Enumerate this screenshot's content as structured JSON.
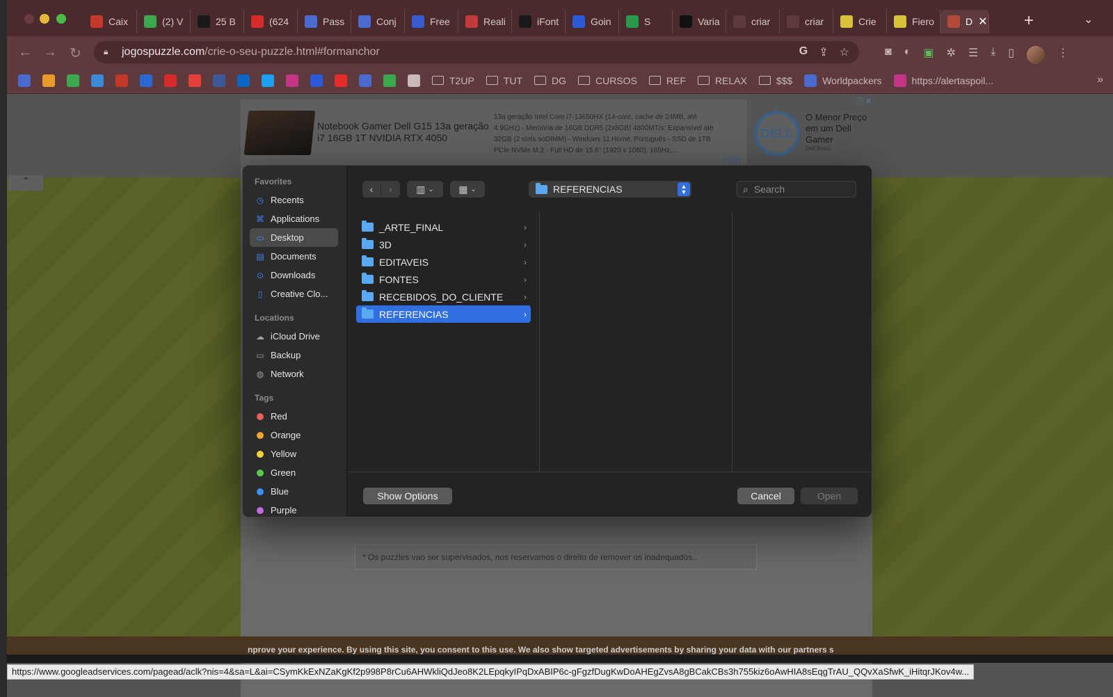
{
  "browser": {
    "tabs": [
      {
        "title": "Caix",
        "icon": "gmail-icon",
        "color": "#c5392b"
      },
      {
        "title": "(2) V",
        "icon": "whatsapp-icon",
        "color": "#3aa94d"
      },
      {
        "title": "25 B",
        "icon": "s-logo-icon",
        "color": "#1a1a1a"
      },
      {
        "title": "(624",
        "icon": "pinterest-icon",
        "color": "#d62b2b"
      },
      {
        "title": "Pass",
        "icon": "forms-icon",
        "color": "#4a6ad0"
      },
      {
        "title": "Conj",
        "icon": "forms-icon",
        "color": "#4a6ad0"
      },
      {
        "title": "Free",
        "icon": "freepik-icon",
        "color": "#3a5ad0"
      },
      {
        "title": "Reali",
        "icon": "realidade-icon",
        "color": "#c23a3a"
      },
      {
        "title": "iFont",
        "icon": "ifont-icon",
        "color": "#1a1a1a"
      },
      {
        "title": "Goin",
        "icon": "behance-icon",
        "color": "#2a5ad8"
      },
      {
        "title": "S",
        "icon": "spotify-icon",
        "color": "#2a9a4a"
      },
      {
        "title": "Varia",
        "icon": "video-icon",
        "color": "#111111"
      },
      {
        "title": "criar",
        "icon": "google-icon",
        "color": "#5f3a3d"
      },
      {
        "title": "criar",
        "icon": "google-icon",
        "color": "#5f3a3d"
      },
      {
        "title": "Crie",
        "icon": "smiley-icon",
        "color": "#d8c23a"
      },
      {
        "title": "Fiero",
        "icon": "smiley-icon",
        "color": "#d8c23a"
      },
      {
        "title": "D",
        "icon": "puzzle-icon",
        "color": "#b24a3a",
        "active": true
      }
    ],
    "url_domain": "jogospuzzle.com",
    "url_path": "/crie-o-seu-puzzle.html#formanchor",
    "bookmarks_folders": [
      "T2UP",
      "TUT",
      "DG",
      "CURSOS",
      "REF",
      "RELAX",
      "$$$"
    ],
    "bookmark_worldpackers": "Worldpackers",
    "bookmark_alerta": "https://alertaspoil...",
    "bookmark_icon_colors": [
      "#4a6ad0",
      "#e89a2a",
      "#3aa94d",
      "#3a8ad8",
      "#c5392b",
      "#2a6ad0",
      "#d62b2b",
      "#e6403a",
      "#3b5998",
      "#0a66c2",
      "#1da1f2",
      "#c13584",
      "#2a5ad8",
      "#e62b2b",
      "#4a6ad0",
      "#3aa94d",
      "#c8b8b8"
    ]
  },
  "ad": {
    "title": "Notebook Gamer Dell G15 13a geração i7 16GB 1T NVIDIA RTX 4050",
    "description": "13a geração Intel Core i7-13650HX (14-core, cache de 24MB, até 4.9GHz) - Memória de 16GB DDR5 (2x8GB) 4800MT/s: Expansível até 32GB (2 slots soDIMM) - Windows 11 Home, Português - SSD de 1TB PCIe NVMe M.2 - Full HD de 15.6\" (1920 x 1080), 165Hz,...",
    "badge": "-9%",
    "brand_logo": "DELL",
    "brand_tagline": "O Menor Preço em um Dell Gamer",
    "brand_sub": "Dell Brasil"
  },
  "page": {
    "notice": "* Os puzzles vao ser supervisados, nos reservamos o direito de remover os inadequados..",
    "cookie_text": "nprove your experience. By using this site, you consent to this use. We also show targeted advertisements by sharing your data with our partners s",
    "status_url": "https://www.googleadservices.com/pagead/aclk?nis=4&sa=L&ai=CSymKkExNZaKgKf2p998P8rCu6AHWkliQdJeo8K2LEpqkyIPqDxABIP6c-gFgzfDugKwDoAHEgZvsA8gBCakCBs3h755kiz6oAwHIA8sEqgTrAU_QQvXaSfwK_iHitqrJKov4w..."
  },
  "dialog": {
    "sidebar": {
      "favorites_heading": "Favorites",
      "favorites": [
        {
          "label": "Recents",
          "icon": "clock-icon"
        },
        {
          "label": "Applications",
          "icon": "applications-icon"
        },
        {
          "label": "Desktop",
          "icon": "desktop-icon",
          "selected": true
        },
        {
          "label": "Documents",
          "icon": "document-icon"
        },
        {
          "label": "Downloads",
          "icon": "download-icon"
        },
        {
          "label": "Creative Clo...",
          "icon": "file-icon"
        }
      ],
      "locations_heading": "Locations",
      "locations": [
        {
          "label": "iCloud Drive",
          "icon": "cloud-icon"
        },
        {
          "label": "Backup",
          "icon": "drive-icon"
        },
        {
          "label": "Network",
          "icon": "globe-icon"
        }
      ],
      "tags_heading": "Tags",
      "tags": [
        {
          "label": "Red",
          "color": "#ec5f5a"
        },
        {
          "label": "Orange",
          "color": "#f3a532"
        },
        {
          "label": "Yellow",
          "color": "#f5d43a"
        },
        {
          "label": "Green",
          "color": "#58c84a"
        },
        {
          "label": "Blue",
          "color": "#3a8ff0"
        },
        {
          "label": "Purple",
          "color": "#c06ae0"
        }
      ]
    },
    "current_folder": "REFERENCIAS",
    "search_placeholder": "Search",
    "folders": [
      {
        "name": "_ARTE_FINAL"
      },
      {
        "name": "3D"
      },
      {
        "name": "EDITAVEIS"
      },
      {
        "name": "FONTES"
      },
      {
        "name": "RECEBIDOS_DO_CLIENTE"
      },
      {
        "name": "REFERENCIAS",
        "selected": true
      }
    ],
    "show_options_label": "Show Options",
    "cancel_label": "Cancel",
    "open_label": "Open",
    "accent_color": "#2f6fe0"
  }
}
